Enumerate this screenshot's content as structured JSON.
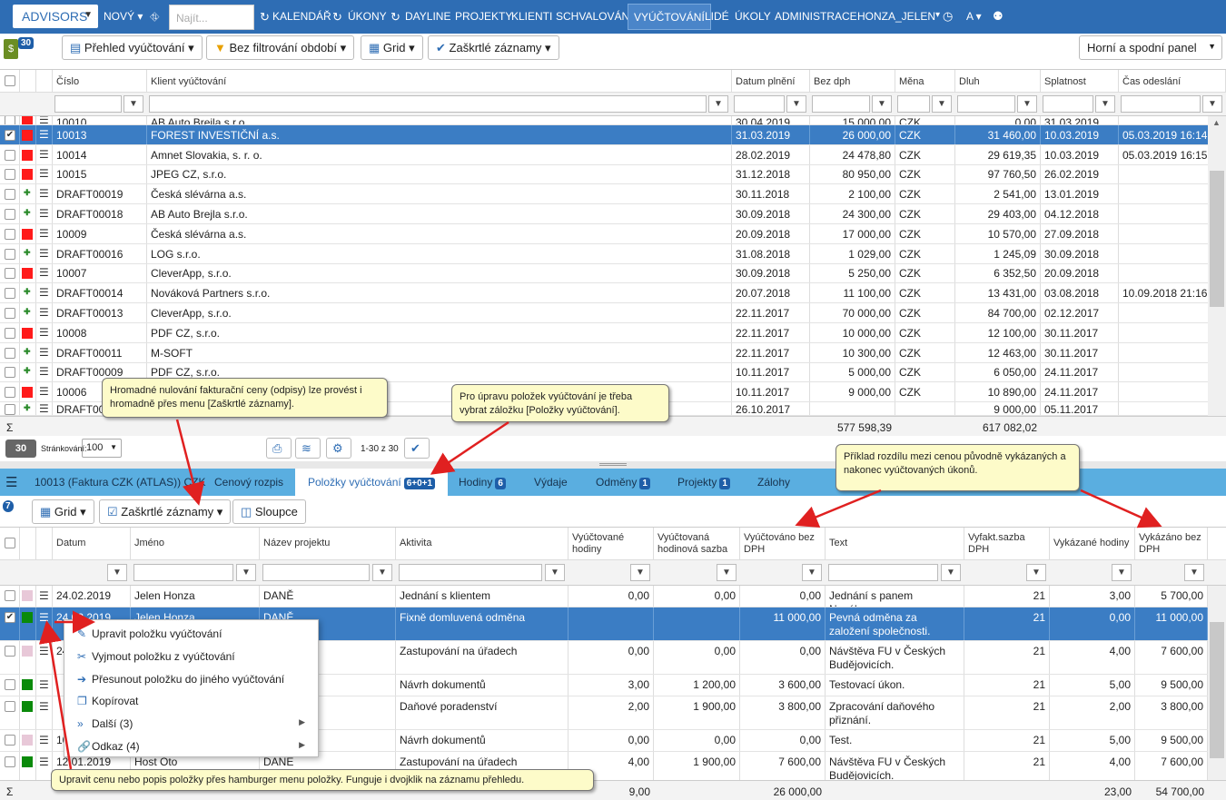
{
  "nav": {
    "brand": "ADVISORS",
    "novy": "NOVÝ",
    "search_placeholder": "Najít...",
    "items": [
      "KALENDÁŘ",
      "ÚKONY",
      "DAYLINE",
      "PROJEKTY",
      "KLIENTI",
      "SCHVALOVÁNÍ",
      "VYÚČTOVÁNÍ",
      "LIDÉ",
      "ÚKOLY",
      "ADMINISTRACE",
      "HONZA_JELEN"
    ],
    "lang": "A"
  },
  "toolbar": {
    "badge": "30",
    "overview": "Přehled vyúčtování",
    "filter": "Bez filtrování období",
    "grid": "Grid",
    "checked": "Zaškrtlé záznamy",
    "panel": "Horní a spodní panel"
  },
  "top_grid": {
    "headers": [
      "Číslo",
      "Klient vyúčtování",
      "Datum plnění",
      "Bez dph",
      "Měna",
      "Dluh",
      "Splatnost",
      "Čas odeslání"
    ],
    "partial_row": [
      "10010",
      "AB Auto Brejla s.r.o.",
      "30.04.2019",
      "15 000,00",
      "CZK",
      "0,00",
      "31.03.2019",
      ""
    ],
    "rows": [
      {
        "mark": "red",
        "checked": true,
        "sel": true,
        "c": [
          "10013",
          "FOREST INVESTIČNÍ a.s.",
          "31.03.2019",
          "26 000,00",
          "CZK",
          "31 460,00",
          "10.03.2019",
          "05.03.2019 16:14"
        ]
      },
      {
        "mark": "red",
        "checked": false,
        "sel": false,
        "c": [
          "10014",
          "Amnet Slovakia, s. r. o.",
          "28.02.2019",
          "24 478,80",
          "CZK",
          "29 619,35",
          "10.03.2019",
          "05.03.2019 16:15"
        ]
      },
      {
        "mark": "red",
        "checked": false,
        "sel": false,
        "c": [
          "10015",
          "JPEG CZ, s.r.o.",
          "31.12.2018",
          "80 950,00",
          "CZK",
          "97 760,50",
          "26.02.2019",
          ""
        ]
      },
      {
        "mark": "pin",
        "checked": false,
        "sel": false,
        "c": [
          "DRAFT00019",
          "Česká slévárna a.s.",
          "30.11.2018",
          "2 100,00",
          "CZK",
          "2 541,00",
          "13.01.2019",
          ""
        ]
      },
      {
        "mark": "pin",
        "checked": false,
        "sel": false,
        "c": [
          "DRAFT00018",
          "AB Auto Brejla s.r.o.",
          "30.09.2018",
          "24 300,00",
          "CZK",
          "29 403,00",
          "04.12.2018",
          ""
        ]
      },
      {
        "mark": "red",
        "checked": false,
        "sel": false,
        "c": [
          "10009",
          "Česká slévárna a.s.",
          "20.09.2018",
          "17 000,00",
          "CZK",
          "10 570,00",
          "27.09.2018",
          ""
        ]
      },
      {
        "mark": "pin",
        "checked": false,
        "sel": false,
        "c": [
          "DRAFT00016",
          "LOG s.r.o.",
          "31.08.2018",
          "1 029,00",
          "CZK",
          "1 245,09",
          "30.09.2018",
          ""
        ]
      },
      {
        "mark": "red",
        "checked": false,
        "sel": false,
        "c": [
          "10007",
          "CleverApp, s.r.o.",
          "30.09.2018",
          "5 250,00",
          "CZK",
          "6 352,50",
          "20.09.2018",
          ""
        ]
      },
      {
        "mark": "pin",
        "checked": false,
        "sel": false,
        "c": [
          "DRAFT00014",
          "Nováková Partners s.r.o.",
          "20.07.2018",
          "11 100,00",
          "CZK",
          "13 431,00",
          "03.08.2018",
          "10.09.2018 21:16"
        ]
      },
      {
        "mark": "pin",
        "checked": false,
        "sel": false,
        "c": [
          "DRAFT00013",
          "CleverApp, s.r.o.",
          "22.11.2017",
          "70 000,00",
          "CZK",
          "84 700,00",
          "02.12.2017",
          ""
        ]
      },
      {
        "mark": "red",
        "checked": false,
        "sel": false,
        "c": [
          "10008",
          "PDF CZ, s.r.o.",
          "22.11.2017",
          "10 000,00",
          "CZK",
          "12 100,00",
          "30.11.2017",
          ""
        ]
      },
      {
        "mark": "pin",
        "checked": false,
        "sel": false,
        "c": [
          "DRAFT00011",
          "M-SOFT",
          "22.11.2017",
          "10 300,00",
          "CZK",
          "12 463,00",
          "30.11.2017",
          ""
        ]
      },
      {
        "mark": "pin",
        "checked": false,
        "sel": false,
        "c": [
          "DRAFT00009",
          "PDF CZ, s.r.o.",
          "10.11.2017",
          "5 000,00",
          "CZK",
          "6 050,00",
          "24.11.2017",
          ""
        ]
      },
      {
        "mark": "red",
        "checked": false,
        "sel": false,
        "c": [
          "10006",
          "",
          "10.11.2017",
          "9 000,00",
          "CZK",
          "10 890,00",
          "24.11.2017",
          ""
        ]
      },
      {
        "mark": "pin",
        "checked": false,
        "sel": false,
        "c": [
          "DRAFT000",
          "",
          "26.10.2017",
          "",
          "",
          "9 000,00",
          "05.11.2017",
          ""
        ]
      }
    ],
    "sum_symbol": "Σ",
    "sum_bez": "577 598,39",
    "sum_dluh": "617 082,02"
  },
  "pager": {
    "count": "30",
    "label": "Stránkování:",
    "size": "100",
    "range": "1-30 z 30"
  },
  "tabs": {
    "invoice": "10013 (Faktura CZK (ATLAS)) CZK",
    "items": [
      {
        "label": "Cenový rozpis",
        "badge": ""
      },
      {
        "label": "Položky vyúčtování",
        "badge": "6+0+1"
      },
      {
        "label": "Hodiny",
        "badge": "6"
      },
      {
        "label": "Výdaje",
        "badge": ""
      },
      {
        "label": "Odměny",
        "badge": "1"
      },
      {
        "label": "Projekty",
        "badge": "1"
      },
      {
        "label": "Zálohy",
        "badge": ""
      }
    ]
  },
  "toolbar2": {
    "badge": "7",
    "grid": "Grid",
    "checked": "Zaškrtlé záznamy",
    "columns": "Sloupce"
  },
  "bottom_grid": {
    "headers": [
      "Datum",
      "Jméno",
      "Název projektu",
      "Aktivita",
      "Vyúčtované hodiny",
      "Vyúčtovaná hodinová sazba",
      "Vyúčtováno bez DPH",
      "Text",
      "Vyfakt.sazba DPH",
      "Vykázané hodiny",
      "Vykázáno bez DPH"
    ],
    "rows": [
      {
        "mark": "pink",
        "checked": false,
        "sel": false,
        "c": [
          "24.02.2019",
          "Jelen Honza",
          "DANĚ",
          "Jednání s klientem",
          "0,00",
          "0,00",
          "0,00",
          "Jednání s panem Novákem.",
          "21",
          "3,00",
          "5 700,00"
        ]
      },
      {
        "mark": "green",
        "checked": true,
        "sel": true,
        "c": [
          "24.02.2019",
          "Jelen Honza",
          "DANĚ",
          "Fixně domluvená odměna",
          "",
          "",
          "11 000,00",
          "Pevná odměna za založení společnosti.",
          "21",
          "0,00",
          "11 000,00"
        ]
      },
      {
        "mark": "pink",
        "checked": false,
        "sel": false,
        "c": [
          "24.02.2019",
          "",
          "",
          "Zastupování na úřadech",
          "0,00",
          "0,00",
          "0,00",
          "Návštěva FU v Českých Budějovicích.",
          "21",
          "4,00",
          "7 600,00"
        ]
      },
      {
        "mark": "green",
        "checked": false,
        "sel": false,
        "c": [
          "",
          "",
          "",
          "Návrh dokumentů",
          "3,00",
          "1 200,00",
          "3 600,00",
          "Testovací úkon.",
          "21",
          "5,00",
          "9 500,00"
        ]
      },
      {
        "mark": "green",
        "checked": false,
        "sel": false,
        "c": [
          "",
          "",
          "",
          "Daňové poradenství",
          "2,00",
          "1 900,00",
          "3 800,00",
          "Zpracování daňového přiznání.",
          "21",
          "2,00",
          "3 800,00"
        ]
      },
      {
        "mark": "pink",
        "checked": false,
        "sel": false,
        "c": [
          "10.01.2019",
          "",
          "",
          "Návrh dokumentů",
          "0,00",
          "0,00",
          "0,00",
          "Test.",
          "21",
          "5,00",
          "9 500,00"
        ]
      },
      {
        "mark": "green",
        "checked": false,
        "sel": false,
        "c": [
          "12.01.2019",
          "Host Oto",
          "DANĚ",
          "Zastupování na úřadech",
          "4,00",
          "1 900,00",
          "7 600,00",
          "Návštěva FU v Českých Budějovicích.",
          "21",
          "4,00",
          "7 600,00"
        ]
      }
    ],
    "sum_symbol": "Σ",
    "sum_hours": "9,00",
    "sum_bez": "26 000,00",
    "sum_vyk_hours": "23,00",
    "sum_vyk_bez": "54 700,00"
  },
  "context_menu": [
    {
      "icon": "✎",
      "label": "Upravit položku vyúčtování",
      "sub": ""
    },
    {
      "icon": "✂",
      "label": "Vyjmout položku z vyúčtování",
      "sub": ""
    },
    {
      "icon": "➔",
      "label": "Přesunout položku do jiného vyúčtování",
      "sub": ""
    },
    {
      "icon": "❐",
      "label": "Kopírovat",
      "sub": ""
    },
    {
      "icon": "»",
      "label": "Další (3)",
      "sub": "▶"
    },
    {
      "icon": "🔗",
      "label": "Odkaz (4)",
      "sub": "▶"
    }
  ],
  "tips": {
    "t1": "Hromadné nulování fakturační ceny (odpisy) lze provést i hromadně přes menu [Zaškrtlé záznamy].",
    "t2": "Pro úpravu položek vyúčtování je třeba vybrat záložku [Položky vyúčtování].",
    "t3": "Příklad rozdílu mezi cenou původně vykázaných a nakonec vyúčtovaných úkonů.",
    "t4": "Upravit cenu nebo popis položky přes hamburger menu položky. Funguje i dvojklik na záznamu přehledu."
  },
  "colors": {
    "nav": "#2e6db4",
    "selected_row": "#3b7dc4",
    "tabbar": "#5aaee0",
    "tooltip": "#fdfbc9",
    "arrow": "#e02020"
  }
}
